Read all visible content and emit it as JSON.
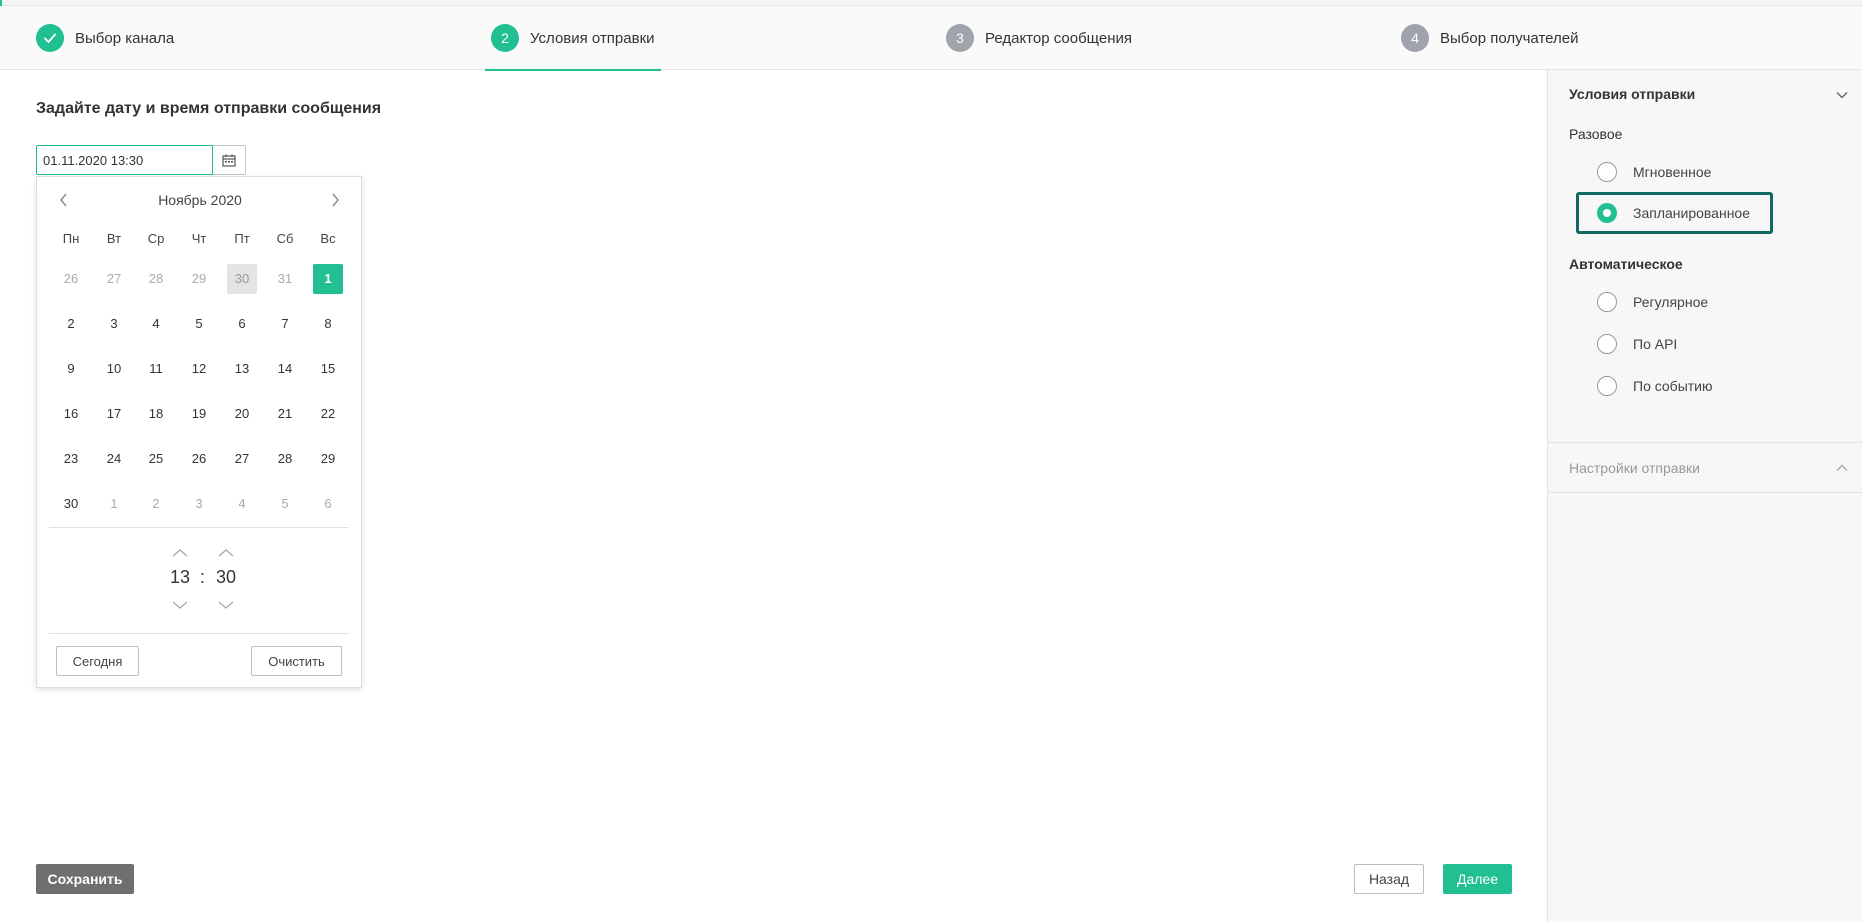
{
  "stepper": {
    "steps": [
      {
        "num": "",
        "label": "Выбор канала",
        "state": "done"
      },
      {
        "num": "2",
        "label": "Условия отправки",
        "state": "active"
      },
      {
        "num": "3",
        "label": "Редактор сообщения",
        "state": "pending"
      },
      {
        "num": "4",
        "label": "Выбор получателей",
        "state": "pending"
      }
    ]
  },
  "main": {
    "title": "Задайте дату и время отправки сообщения",
    "date_value": "01.11.2020 13:30"
  },
  "calendar": {
    "month_label": "Ноябрь 2020",
    "weekdays": [
      "Пн",
      "Вт",
      "Ср",
      "Чт",
      "Пт",
      "Сб",
      "Вс"
    ],
    "weeks": [
      [
        "26",
        "27",
        "28",
        "29",
        "30",
        "31",
        "1"
      ],
      [
        "2",
        "3",
        "4",
        "5",
        "6",
        "7",
        "8"
      ],
      [
        "9",
        "10",
        "11",
        "12",
        "13",
        "14",
        "15"
      ],
      [
        "16",
        "17",
        "18",
        "19",
        "20",
        "21",
        "22"
      ],
      [
        "23",
        "24",
        "25",
        "26",
        "27",
        "28",
        "29"
      ],
      [
        "30",
        "1",
        "2",
        "3",
        "4",
        "5",
        "6"
      ]
    ],
    "hours": "13",
    "minutes": "30",
    "colon": ":",
    "today_label": "Сегодня",
    "clear_label": "Очистить"
  },
  "buttons": {
    "save": "Сохранить",
    "back": "Назад",
    "next": "Далее"
  },
  "panel": {
    "title": "Условия отправки",
    "group_one_time": "Разовое",
    "group_auto": "Автоматическое",
    "options": {
      "instant": "Мгновенное",
      "scheduled": "Запланированное",
      "regular": "Регулярное",
      "api": "По API",
      "event": "По событию"
    },
    "selected": "scheduled",
    "settings_title": "Настройки отправки"
  },
  "colors": {
    "accent": "#21bf91",
    "highlight_border": "#0f6b62",
    "step_pending": "#9fa3ab"
  }
}
